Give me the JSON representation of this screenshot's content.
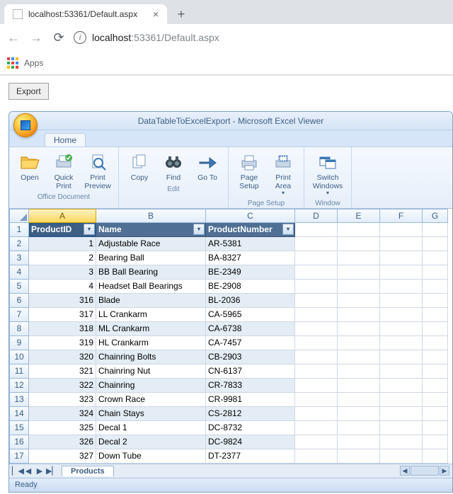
{
  "browser": {
    "tab_title": "localhost:53361/Default.aspx",
    "url_info_tooltip": "i",
    "url_host": "localhost",
    "url_port_path": ":53361/Default.aspx",
    "apps_label": "Apps"
  },
  "page": {
    "export_button": "Export"
  },
  "viewer": {
    "title": "DataTableToExcelExport - Microsoft Excel Viewer",
    "home_tab": "Home",
    "groups": {
      "office_doc": {
        "title": "Office Document",
        "open": "Open",
        "quick_print": "Quick Print",
        "print_preview": "Print Preview"
      },
      "edit": {
        "title": "Edit",
        "copy": "Copy",
        "find": "Find",
        "go_to": "Go To"
      },
      "page_setup": {
        "title": "Page Setup",
        "page_setup": "Page Setup",
        "print_area": "Print Area"
      },
      "window": {
        "title": "Window",
        "switch_windows": "Switch Windows"
      }
    },
    "columns": [
      "A",
      "B",
      "C",
      "D",
      "E",
      "F",
      "G"
    ],
    "headers": {
      "a": "ProductID",
      "b": "Name",
      "c": "ProductNumber"
    },
    "rows": [
      {
        "n": 1,
        "id": 1,
        "name": "Adjustable Race",
        "pn": "AR-5381",
        "band": true
      },
      {
        "n": 2,
        "id": 2,
        "name": "Bearing Ball",
        "pn": "BA-8327",
        "band": false
      },
      {
        "n": 3,
        "id": 3,
        "name": "BB Ball Bearing",
        "pn": "BE-2349",
        "band": true
      },
      {
        "n": 4,
        "id": 4,
        "name": "Headset Ball Bearings",
        "pn": "BE-2908",
        "band": false
      },
      {
        "n": 5,
        "id": 316,
        "name": "Blade",
        "pn": "BL-2036",
        "band": true
      },
      {
        "n": 6,
        "id": 317,
        "name": "LL Crankarm",
        "pn": "CA-5965",
        "band": false
      },
      {
        "n": 7,
        "id": 318,
        "name": "ML Crankarm",
        "pn": "CA-6738",
        "band": true
      },
      {
        "n": 8,
        "id": 319,
        "name": "HL Crankarm",
        "pn": "CA-7457",
        "band": false
      },
      {
        "n": 9,
        "id": 320,
        "name": "Chainring Bolts",
        "pn": "CB-2903",
        "band": true
      },
      {
        "n": 10,
        "id": 321,
        "name": "Chainring Nut",
        "pn": "CN-6137",
        "band": false
      },
      {
        "n": 11,
        "id": 322,
        "name": "Chainring",
        "pn": "CR-7833",
        "band": true
      },
      {
        "n": 12,
        "id": 323,
        "name": "Crown Race",
        "pn": "CR-9981",
        "band": false
      },
      {
        "n": 13,
        "id": 324,
        "name": "Chain Stays",
        "pn": "CS-2812",
        "band": true
      },
      {
        "n": 14,
        "id": 325,
        "name": "Decal 1",
        "pn": "DC-8732",
        "band": false
      },
      {
        "n": 15,
        "id": 326,
        "name": "Decal 2",
        "pn": "DC-9824",
        "band": true
      },
      {
        "n": 16,
        "id": 327,
        "name": "Down Tube",
        "pn": "DT-2377",
        "band": false
      }
    ],
    "sheet_tab": "Products",
    "status": "Ready"
  }
}
